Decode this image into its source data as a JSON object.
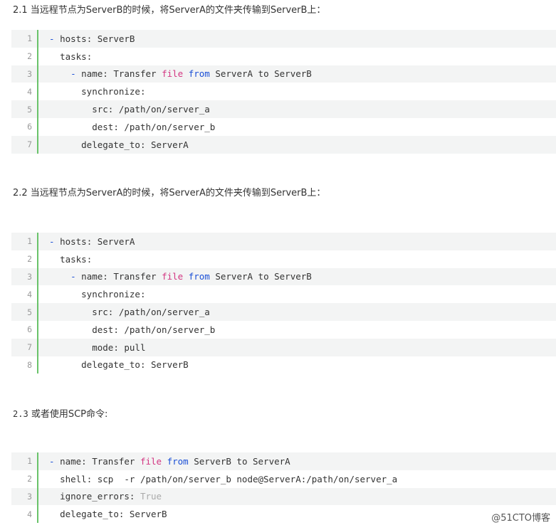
{
  "sections": [
    {
      "heading": "2.1 当远程节点为ServerB的时候，将ServerA的文件夹传输到ServerB上：",
      "lines": [
        {
          "num": "1",
          "indent": "",
          "dash": "- ",
          "text": "hosts: ServerB"
        },
        {
          "num": "2",
          "indent": "  ",
          "text": "tasks:"
        },
        {
          "num": "3",
          "indent": "    ",
          "dash": "- ",
          "pre": "name: Transfer ",
          "kw1": "file",
          "sp1": " ",
          "kw2": "from",
          "post": " ServerA to ServerB"
        },
        {
          "num": "4",
          "indent": "      ",
          "text": "synchronize:"
        },
        {
          "num": "5",
          "indent": "        ",
          "text": "src: /path/on/server_a"
        },
        {
          "num": "6",
          "indent": "        ",
          "text": "dest: /path/on/server_b"
        },
        {
          "num": "7",
          "indent": "      ",
          "text": "delegate_to: ServerA"
        }
      ]
    },
    {
      "heading": "2.2 当远程节点为ServerA的时候，将ServerA的文件夹传输到ServerB上：",
      "lines": [
        {
          "num": "1",
          "indent": "",
          "dash": "- ",
          "text": "hosts: ServerA"
        },
        {
          "num": "2",
          "indent": "  ",
          "text": "tasks:"
        },
        {
          "num": "3",
          "indent": "    ",
          "dash": "- ",
          "pre": "name: Transfer ",
          "kw1": "file",
          "sp1": " ",
          "kw2": "from",
          "post": " ServerA to ServerB"
        },
        {
          "num": "4",
          "indent": "      ",
          "text": "synchronize:"
        },
        {
          "num": "5",
          "indent": "        ",
          "text": "src: /path/on/server_a"
        },
        {
          "num": "6",
          "indent": "        ",
          "text": "dest: /path/on/server_b"
        },
        {
          "num": "7",
          "indent": "        ",
          "text": "mode: pull"
        },
        {
          "num": "8",
          "indent": "      ",
          "text": "delegate_to: ServerB"
        }
      ]
    },
    {
      "heading_num": "2.3",
      "heading": "或者使用SCP命令:",
      "lines": [
        {
          "num": "1",
          "indent": "",
          "dash": "- ",
          "pre": "name: Transfer ",
          "kw1": "file",
          "sp1": " ",
          "kw2": "from",
          "post": " ServerB to ServerA"
        },
        {
          "num": "2",
          "indent": "  ",
          "text": "shell: scp  -r /path/on/server_b node@ServerA:/path/on/server_a"
        },
        {
          "num": "3",
          "indent": "  ",
          "pre": "ignore_errors: ",
          "bool": "True"
        },
        {
          "num": "4",
          "indent": "  ",
          "text": "delegate_to: ServerB"
        }
      ]
    }
  ],
  "watermark": "@51CTO博客",
  "colors": {
    "gutter_border": "#6ac36a",
    "row_alt": "#f3f4f4",
    "keyword": "#d33682",
    "from_keyword": "#1a4fd6",
    "boolean": "#aaaaaa"
  }
}
